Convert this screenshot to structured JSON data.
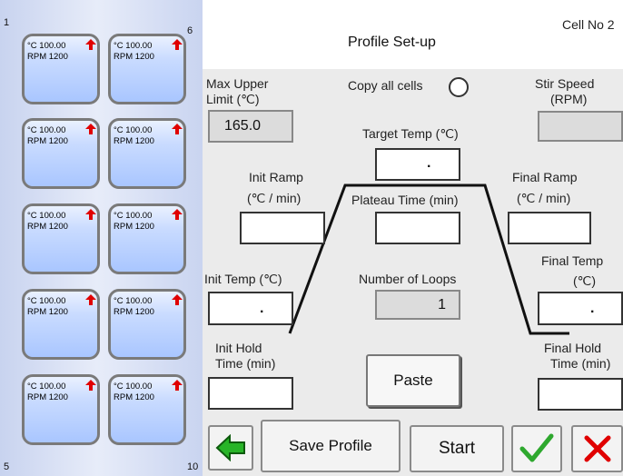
{
  "cells": {
    "left_top_number": "1",
    "right_top_number": "6",
    "left_bottom_number": "5",
    "right_bottom_number": "10",
    "items": [
      {
        "temp": "°C 100.00",
        "rpm": "RPM 1200"
      },
      {
        "temp": "°C 100.00",
        "rpm": "RPM 1200"
      },
      {
        "temp": "°C 100.00",
        "rpm": "RPM 1200"
      },
      {
        "temp": "°C 100.00",
        "rpm": "RPM 1200"
      },
      {
        "temp": "°C 100.00",
        "rpm": "RPM 1200"
      },
      {
        "temp": "°C 100.00",
        "rpm": "RPM 1200"
      },
      {
        "temp": "°C 100.00",
        "rpm": "RPM 1200"
      },
      {
        "temp": "°C 100.00",
        "rpm": "RPM 1200"
      },
      {
        "temp": "°C 100.00",
        "rpm": "RPM 1200"
      },
      {
        "temp": "°C 100.00",
        "rpm": "RPM 1200"
      }
    ],
    "arrow_icon": "up-arrow-icon",
    "arrow_color": "#e00000"
  },
  "header": {
    "title": "Profile Set-up",
    "cell_no": "Cell No  2"
  },
  "settings": {
    "max_upper_limit_label_1": "Max Upper",
    "max_upper_limit_label_2": "Limit (℃)",
    "max_upper_limit_value": "165.0",
    "copy_all_cells_label": "Copy all cells",
    "stir_speed_label_1": "Stir Speed",
    "stir_speed_label_2": "(RPM)",
    "stir_speed_value": "",
    "target_temp_label": "Target Temp (℃)",
    "target_temp_value": ".",
    "init_ramp_label_1": "Init Ramp",
    "init_ramp_label_2": "(℃ / min)",
    "init_ramp_value": "",
    "plateau_time_label": "Plateau Time (min)",
    "plateau_time_value": "",
    "final_ramp_label_1": "Final Ramp",
    "final_ramp_label_2": "(℃ / min)",
    "final_ramp_value": "",
    "init_temp_label": "Init Temp (℃)",
    "init_temp_value": ".",
    "number_of_loops_label": "Number of Loops",
    "number_of_loops_value": "1",
    "final_temp_label_1": "Final Temp",
    "final_temp_label_2": "(℃)",
    "final_temp_value": ".",
    "init_hold_label_1": "Init Hold",
    "init_hold_label_2": "Time (min)",
    "init_hold_value": "",
    "paste_label": "Paste",
    "final_hold_label_1": "Final Hold",
    "final_hold_label_2": "Time (min)",
    "final_hold_value": ""
  },
  "toolbar": {
    "back_icon": "back-arrow-icon",
    "save_profile_label": "Save Profile",
    "start_label": "Start",
    "confirm_icon": "check-icon",
    "cancel_icon": "close-icon",
    "accent_green": "#2ea82e",
    "accent_red": "#e00000"
  }
}
